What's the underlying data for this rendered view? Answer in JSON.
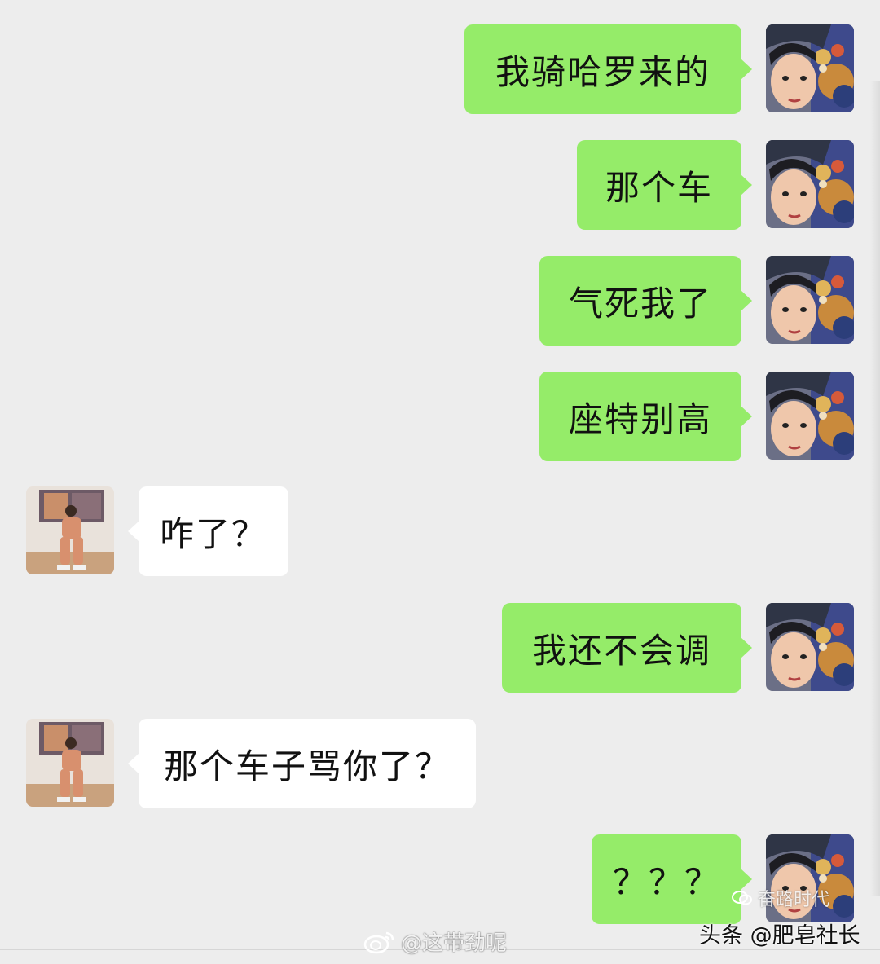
{
  "conversation": {
    "messages": [
      {
        "side": "sent",
        "text": "我骑哈罗来的"
      },
      {
        "side": "sent",
        "text": "那个车"
      },
      {
        "side": "sent",
        "text": "气死我了"
      },
      {
        "side": "sent",
        "text": "座特别高"
      },
      {
        "side": "recv",
        "text": "咋了？"
      },
      {
        "side": "sent",
        "text": "我还不会调"
      },
      {
        "side": "recv",
        "text": "那个车子骂你了？"
      },
      {
        "side": "sent",
        "text": "？？？"
      }
    ]
  },
  "watermarks": {
    "weibo": "@这带劲呢",
    "toutiao_top": "奋路时代",
    "toutiao": "头条 @肥皂社长"
  },
  "colors": {
    "background": "#ededed",
    "sent_bubble": "#95ec69",
    "received_bubble": "#ffffff"
  }
}
